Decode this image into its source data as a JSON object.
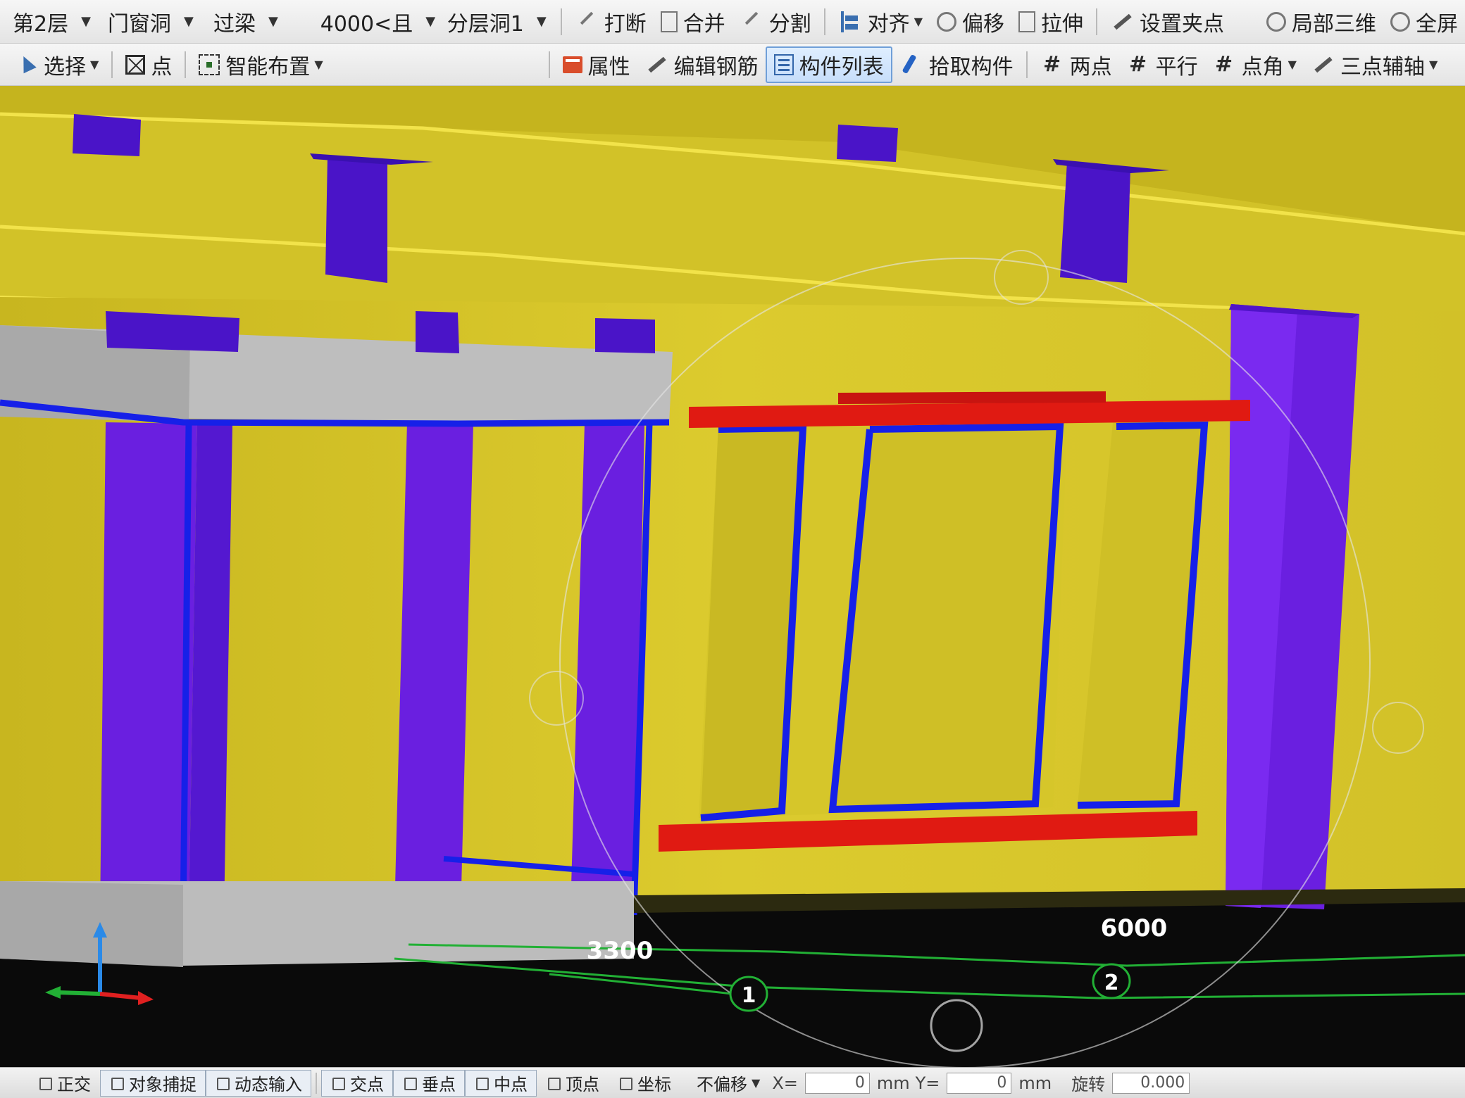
{
  "toolbar_top": {
    "floor_combo": "第2层",
    "type_combo": "门窗洞",
    "element_combo": "过梁",
    "component_combo": "4000<且",
    "layer_combo": "分层洞1",
    "partial_items": [
      {
        "label": "打断",
        "icon": "break-icon"
      },
      {
        "label": "合并",
        "icon": "merge-icon"
      },
      {
        "label": "分割",
        "icon": "split-icon"
      }
    ],
    "align_label": "对齐",
    "offset_label": "偏移",
    "stretch_label": "拉伸",
    "set_grip_label": "设置夹点",
    "local_3d_label": "局部三维",
    "fullscreen_label": "全屏"
  },
  "toolbar_second": {
    "select_label": "选择",
    "point_label": "点",
    "smart_place_label": "智能布置",
    "property_label": "属性",
    "edit_rebar_label": "编辑钢筋",
    "component_list_label": "构件列表",
    "pick_component_label": "拾取构件",
    "two_point_label": "两点",
    "parallel_label": "平行",
    "point_angle_label": "点角",
    "three_point_axis_label": "三点辅轴"
  },
  "viewport": {
    "axis_labels": [
      {
        "number": "1",
        "dimension": "3300"
      },
      {
        "number": "2",
        "dimension": "6000"
      }
    ],
    "colors": {
      "wall": "#d6c62a",
      "column": "#6a1fe0",
      "lintel": "#e01a12",
      "frame_edge": "#1620e8",
      "slab": "#b8b8b8",
      "axis_line": "#22b035",
      "background": "#0a0a0a"
    }
  },
  "status_bar": {
    "ortho_label": "正交",
    "snap_label": "对象捕捉",
    "dynamic_input_label": "动态输入",
    "intersection_label": "交点",
    "perpendicular_label": "垂点",
    "midpoint_label": "中点",
    "vertex_label": "顶点",
    "coordinate_label": "坐标",
    "offset_mode": "不偏移",
    "x_label": "X=",
    "x_value": "0",
    "unit_mm_x": "mm",
    "y_label": "Y=",
    "y_value": "0",
    "unit_mm_y": "mm",
    "rotate_label": "旋转",
    "rotate_value": "0.000"
  }
}
